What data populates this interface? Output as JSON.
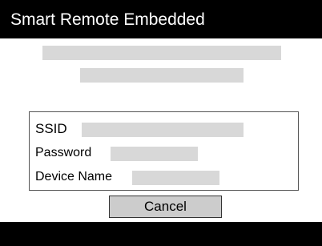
{
  "title_bar": {
    "title": "Smart Remote Embedded"
  },
  "info_box": {
    "fields": [
      {
        "label": "SSID"
      },
      {
        "label": "Password"
      },
      {
        "label": "Device Name"
      }
    ]
  },
  "actions": {
    "cancel_label": "Cancel"
  },
  "colors": {
    "title_bar_bg": "#000000",
    "placeholder_gray": "#d8d8d8",
    "button_gray": "#cccccc"
  }
}
